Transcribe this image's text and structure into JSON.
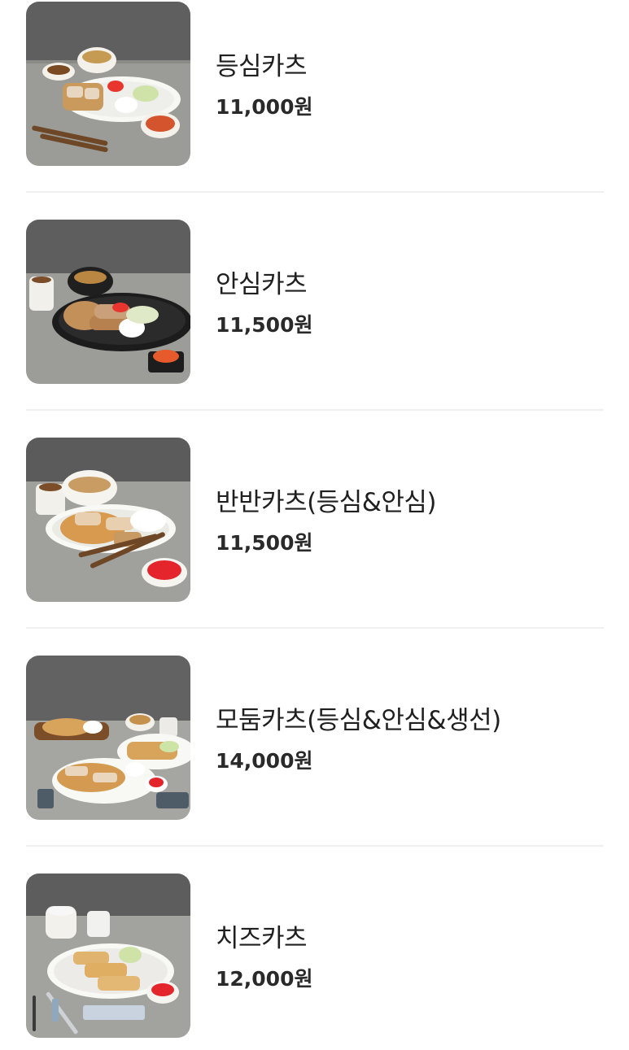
{
  "menu": {
    "items": [
      {
        "name": "등심카츠",
        "price": "11,000원",
        "image_icon": "pork-loin-cutlet-photo",
        "plate": "white",
        "cutlet_color": "#c99a5c"
      },
      {
        "name": "안심카츠",
        "price": "11,500원",
        "image_icon": "pork-tenderloin-cutlet-photo",
        "plate": "black",
        "cutlet_color": "#c4905a"
      },
      {
        "name": "반반카츠(등심&안심)",
        "price": "11,500원",
        "image_icon": "half-half-cutlet-photo",
        "plate": "white",
        "cutlet_color": "#d79a4f"
      },
      {
        "name": "모둠카츠(등심&안심&생선)",
        "price": "14,000원",
        "image_icon": "assorted-cutlet-photo",
        "plate": "white",
        "cutlet_color": "#d8a35a"
      },
      {
        "name": "치즈카츠",
        "price": "12,000원",
        "image_icon": "cheese-cutlet-photo",
        "plate": "white",
        "cutlet_color": "#e0b46e"
      }
    ]
  },
  "colors": {
    "text": "#1f1f1f",
    "wall": "#5f5f5f",
    "table": "#9a9a98",
    "divider": "#f0f0f0"
  }
}
